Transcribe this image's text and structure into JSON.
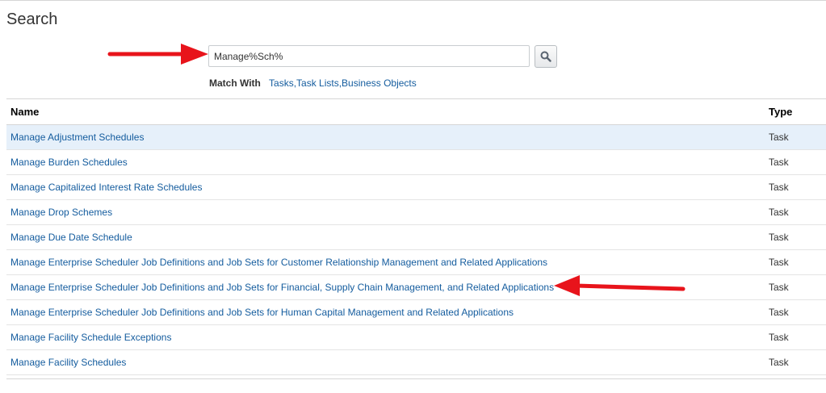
{
  "page": {
    "title": "Search"
  },
  "search": {
    "value": "Manage%Sch%",
    "button_icon": "search-icon"
  },
  "match": {
    "label": "Match With",
    "options": [
      "Tasks,",
      "Task Lists,",
      "Business Objects"
    ]
  },
  "table": {
    "headers": {
      "name": "Name",
      "type": "Type"
    },
    "rows": [
      {
        "name": "Manage Adjustment Schedules",
        "type": "Task"
      },
      {
        "name": "Manage Burden Schedules",
        "type": "Task"
      },
      {
        "name": "Manage Capitalized Interest Rate Schedules",
        "type": "Task"
      },
      {
        "name": "Manage Drop Schemes",
        "type": "Task"
      },
      {
        "name": "Manage Due Date Schedule",
        "type": "Task"
      },
      {
        "name": "Manage Enterprise Scheduler Job Definitions and Job Sets for Customer Relationship Management and Related Applications",
        "type": "Task"
      },
      {
        "name": "Manage Enterprise Scheduler Job Definitions and Job Sets for Financial, Supply Chain Management, and Related Applications",
        "type": "Task"
      },
      {
        "name": "Manage Enterprise Scheduler Job Definitions and Job Sets for Human Capital Management and Related Applications",
        "type": "Task"
      },
      {
        "name": "Manage Facility Schedule Exceptions",
        "type": "Task"
      },
      {
        "name": "Manage Facility Schedules",
        "type": "Task"
      }
    ]
  },
  "colors": {
    "link": "#145c9e",
    "selected_row": "#e6f0fa",
    "annotation_arrow": "#e8141b"
  }
}
